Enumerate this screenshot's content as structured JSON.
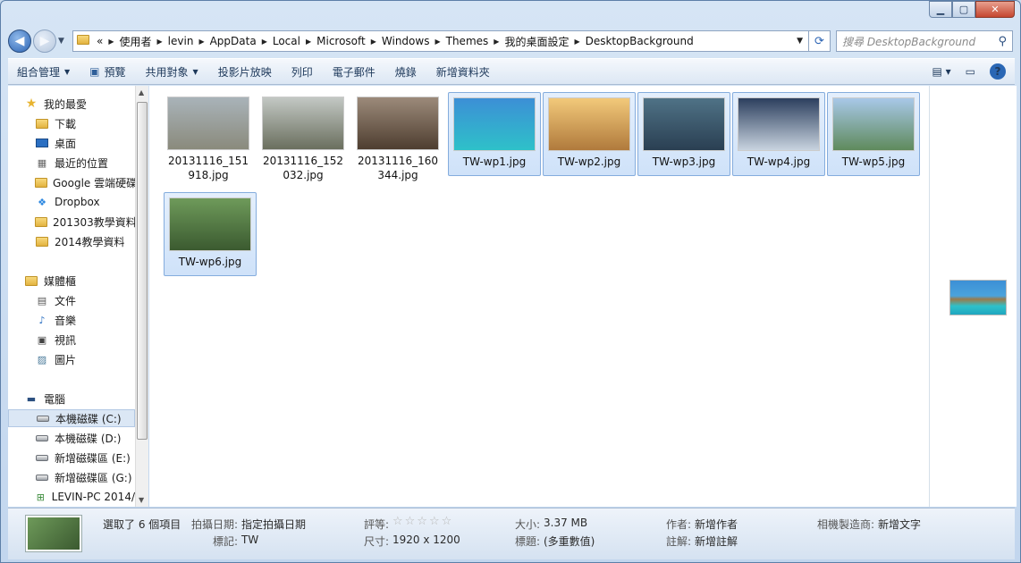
{
  "window": {
    "caption_buttons": {
      "minimize": "▁",
      "maximize": "▢",
      "close": "✕"
    }
  },
  "address": {
    "chevrons": "«",
    "crumbs": [
      "使用者",
      "levin",
      "AppData",
      "Local",
      "Microsoft",
      "Windows",
      "Themes",
      "我的桌面設定",
      "DesktopBackground"
    ],
    "search_placeholder": "搜尋 DesktopBackground"
  },
  "toolbar": {
    "organize": "組合管理",
    "preview": "預覽",
    "share": "共用對象",
    "slideshow": "投影片放映",
    "print": "列印",
    "email": "電子郵件",
    "burn": "燒錄",
    "new_folder": "新增資料夾",
    "help": "?"
  },
  "nav": {
    "favorites_header": "我的最愛",
    "favorites": [
      "下載",
      "桌面",
      "最近的位置",
      "Google 雲端硬碟",
      "Dropbox",
      "201303教學資料",
      "2014教學資料"
    ],
    "libraries_header": "媒體櫃",
    "libraries": [
      "文件",
      "音樂",
      "視訊",
      "圖片"
    ],
    "computer_header": "電腦",
    "drives": [
      "本機磁碟 (C:)",
      "本機磁碟 (D:)",
      "新增磁碟區 (E:)",
      "新增磁碟區 (G:)",
      "LEVIN-PC 2014/"
    ]
  },
  "files": [
    {
      "name": "20131116_151918.jpg",
      "selected": false,
      "colors": [
        "#a9b3b9",
        "#8a8a7c"
      ]
    },
    {
      "name": "20131116_152032.jpg",
      "selected": false,
      "colors": [
        "#c3c8c4",
        "#6a6f5e"
      ]
    },
    {
      "name": "20131116_160344.jpg",
      "selected": false,
      "colors": [
        "#9c8a7a",
        "#4e3e30"
      ]
    },
    {
      "name": "TW-wp1.jpg",
      "selected": true,
      "colors": [
        "#3c8fd6",
        "#2ec1c9"
      ]
    },
    {
      "name": "TW-wp2.jpg",
      "selected": true,
      "colors": [
        "#f2c97a",
        "#b07a3c"
      ]
    },
    {
      "name": "TW-wp3.jpg",
      "selected": true,
      "colors": [
        "#4f7286",
        "#2a3f52"
      ]
    },
    {
      "name": "TW-wp4.jpg",
      "selected": true,
      "colors": [
        "#2c3f5e",
        "#c8d3df"
      ]
    },
    {
      "name": "TW-wp5.jpg",
      "selected": true,
      "colors": [
        "#a8c8e8",
        "#5f8a5c"
      ]
    },
    {
      "name": "TW-wp6.jpg",
      "selected": true,
      "colors": [
        "#6e9a5a",
        "#3b5a30"
      ]
    }
  ],
  "details": {
    "selected_count": "選取了 6 個項目",
    "date_taken_key": "拍攝日期:",
    "date_taken_val": "指定拍攝日期",
    "tags_key": "標記:",
    "tags_val": "TW",
    "rating_key": "評等:",
    "rating_val": "☆☆☆☆☆",
    "dimensions_key": "尺寸:",
    "dimensions_val": "1920 x 1200",
    "size_key": "大小:",
    "size_val": "3.37 MB",
    "title_key": "標題:",
    "title_val": "(多重數值)",
    "author_key": "作者:",
    "author_val": "新增作者",
    "comments_key": "註解:",
    "comments_val": "新增註解",
    "maker_key": "相機製造商:",
    "maker_val": "新增文字"
  }
}
